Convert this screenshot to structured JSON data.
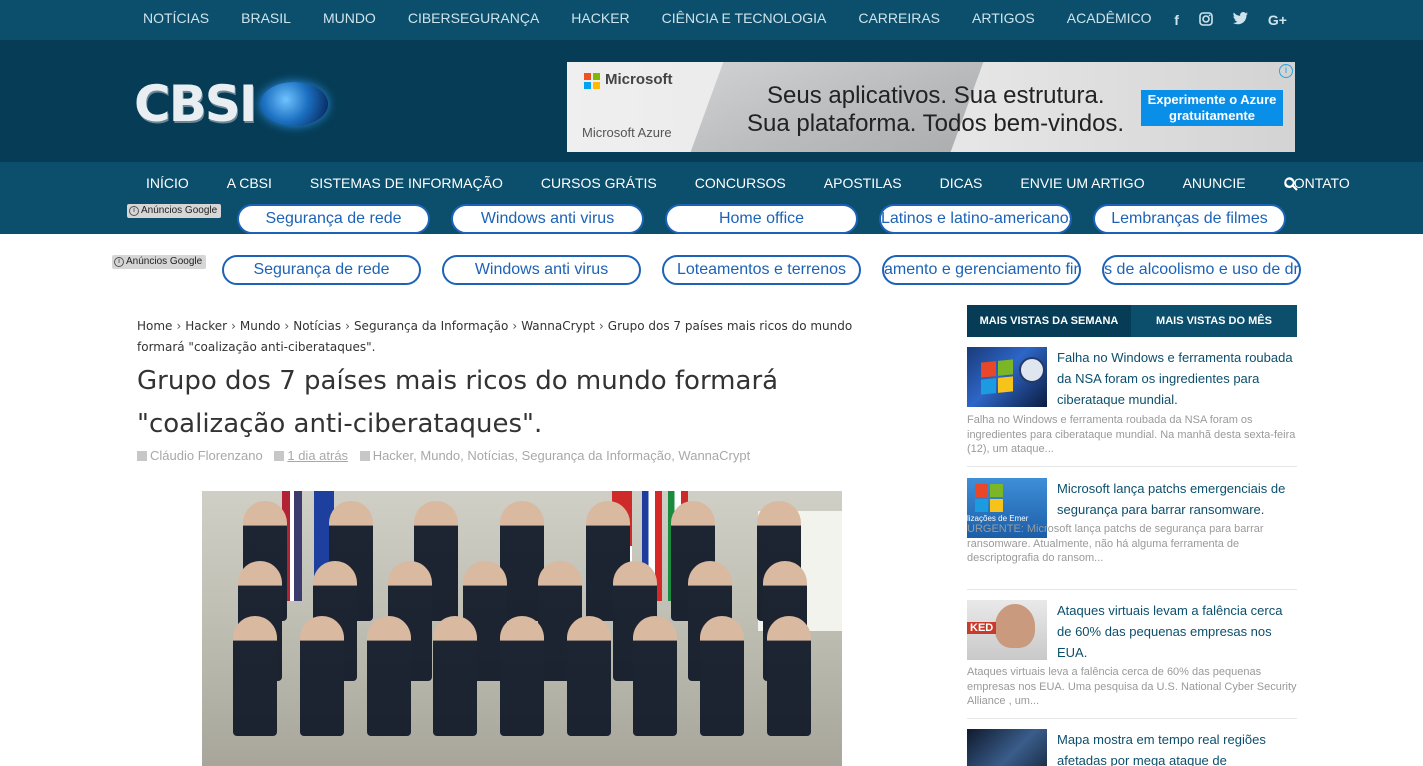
{
  "topbar": {
    "links": [
      "NOTÍCIAS",
      "BRASIL",
      "MUNDO",
      "CIBERSEGURANÇA",
      "HACKER",
      "CIÊNCIA E TECNOLOGIA",
      "CARREIRAS",
      "ARTIGOS",
      "ACADÊMICO"
    ],
    "social": {
      "facebook": "f",
      "instagram": "◙",
      "twitter": "🐦",
      "googleplus": "G+"
    }
  },
  "header": {
    "logo_text": "CBSI",
    "ad": {
      "brand": "Microsoft",
      "product": "Microsoft Azure",
      "line1": "Seus aplicativos. Sua estrutura.",
      "line2": "Sua plataforma. Todos bem-vindos.",
      "cta": "Experimente o Azure gratuitamente",
      "ms_colors": [
        "#f25022",
        "#7fba00",
        "#00a4ef",
        "#ffb900"
      ]
    }
  },
  "mainnav": {
    "links": [
      "INÍCIO",
      "A CBSI",
      "SISTEMAS DE INFORMAÇÃO",
      "CURSOS GRÁTIS",
      "CONCURSOS",
      "APOSTILAS",
      "DICAS",
      "ENVIE UM ARTIGO",
      "ANUNCIE",
      "CONTATO"
    ]
  },
  "ads": {
    "label": "Anúncios Google",
    "row1": [
      "Segurança de rede",
      "Windows anti virus",
      "Home office",
      "Latinos e latino-americanos",
      "Lembranças de filmes"
    ],
    "row2": [
      "Segurança de rede",
      "Windows anti virus",
      "Loteamentos e terrenos",
      "amento e gerenciamento fina",
      "s de alcoolismo e uso de dr"
    ]
  },
  "breadcrumb": {
    "items": [
      "Home",
      "Hacker",
      "Mundo",
      "Notícias",
      "Segurança da Informação",
      "WannaCrypt"
    ],
    "current": "Grupo dos 7 países mais ricos do mundo formará \"coalização anti-ciberataques\"."
  },
  "article": {
    "title": "Grupo dos 7 países mais ricos do mundo formará \"coalização anti-ciberataques\".",
    "author": "Cláudio Florenzano",
    "date": "1 dia atrás",
    "categories": [
      "Hacker",
      "Mundo",
      "Notícias",
      "Segurança da Informação",
      "WannaCrypt"
    ]
  },
  "sidebar": {
    "tabs": [
      "MAIS VISTAS DA SEMANA",
      "MAIS VISTAS DO MÊS"
    ],
    "items": [
      {
        "title": "Falha no Windows e ferramenta roubada da NSA foram os ingredientes para ciberataque mundial.",
        "excerpt": "Falha no Windows e ferramenta roubada da NSA foram os ingredientes para ciberataque mundial. Na manhã desta sexta-feira (12), um ataque..."
      },
      {
        "title": "Microsoft lança patchs emergenciais de segurança para barrar ransomware.",
        "excerpt": "URGENTE: Microsoft lança patchs de segurança para barrar ransomware. Atualmente, não há alguma ferramenta de descriptografia do ransom..."
      },
      {
        "title": "Ataques virtuais levam a falência cerca de 60% das pequenas empresas nos EUA.",
        "excerpt": "Ataques virtuais leva a falência cerca de 60% das pequenas empresas nos EUA. Uma pesquisa da U.S. National Cyber Security Alliance , um..."
      },
      {
        "title": "Mapa mostra em tempo real regiões afetadas por mega ataque de",
        "excerpt": ""
      }
    ],
    "thumb_text": {
      "1": "lizações de Emer",
      "2": "KED"
    }
  }
}
